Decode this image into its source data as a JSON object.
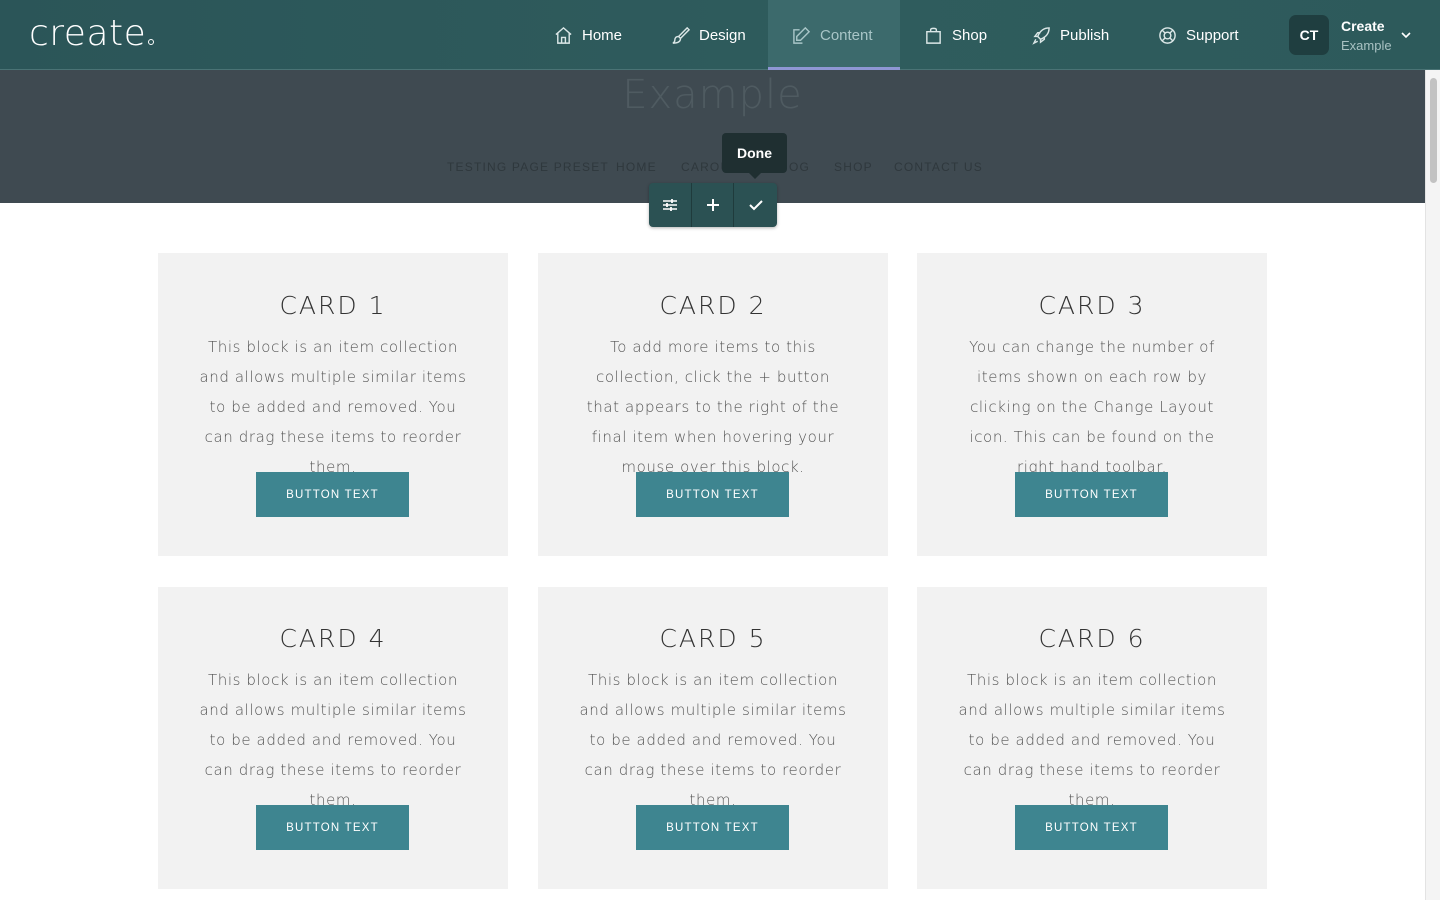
{
  "app": {
    "logo_text": "create"
  },
  "nav": {
    "items": [
      {
        "label": "Home",
        "icon": "home-icon"
      },
      {
        "label": "Design",
        "icon": "brush-icon"
      },
      {
        "label": "Content",
        "icon": "edit-icon",
        "active": true
      },
      {
        "label": "Shop",
        "icon": "shopping-bag-icon"
      },
      {
        "label": "Publish",
        "icon": "rocket-icon"
      },
      {
        "label": "Support",
        "icon": "lifebuoy-icon"
      }
    ]
  },
  "account": {
    "initials": "CT",
    "name": "Create",
    "subtitle": "Example"
  },
  "site": {
    "title": "Example",
    "nav": [
      "TESTING PAGE PRESET",
      "HOME",
      "CAROU",
      "OG",
      "SHOP",
      "CONTACT US"
    ]
  },
  "toolbar": {
    "tooltip": "Done",
    "buttons": [
      "settings-sliders-icon",
      "plus-icon",
      "check-icon"
    ]
  },
  "cards": [
    {
      "title": "CARD 1",
      "body": "This block is an item collection and allows multiple similar items to be added and removed. You can drag these items to reorder them.",
      "button": "BUTTON TEXT"
    },
    {
      "title": "CARD 2",
      "body": "To add more items to this collection, click the + button that appears to the right of the final item when hovering your mouse over this block.",
      "button": "BUTTON TEXT"
    },
    {
      "title": "CARD 3",
      "body": "You can change the number of items shown on each row by clicking on the Change Layout icon. This can be found on the right hand toolbar.",
      "button": "BUTTON TEXT"
    },
    {
      "title": "CARD 4",
      "body": "This block is an item collection and allows multiple similar items to be added and removed. You can drag these items to reorder them.",
      "button": "BUTTON TEXT"
    },
    {
      "title": "CARD 5",
      "body": "This block is an item collection and allows multiple similar items to be added and removed. You can drag these items to reorder them.",
      "button": "BUTTON TEXT"
    },
    {
      "title": "CARD 6",
      "body": "This block is an item collection and allows multiple similar items to be added and removed. You can drag these items to reorder them.",
      "button": "BUTTON TEXT"
    }
  ],
  "colors": {
    "appbar": "#2f5c5d",
    "active_underline": "#8f97d4",
    "header_bg": "#3f4a51",
    "card_bg": "#f2f2f2",
    "button_bg": "#3e8590"
  }
}
